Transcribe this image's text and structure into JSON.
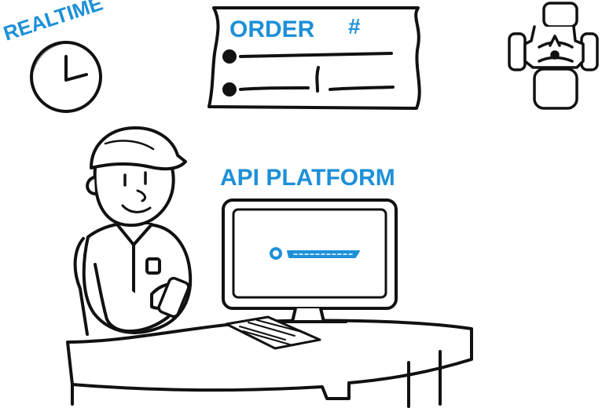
{
  "labels": {
    "realtime": "REALTIME",
    "order": "ORDER",
    "order_hash": "#",
    "api_platform": "API PLATFORM"
  },
  "colors": {
    "ink": "#111111",
    "accent_blue": "#1e90d8",
    "paper": "#ffffff",
    "soft_gray": "#f3f3f3"
  },
  "icons": {
    "clock": "clock-icon",
    "order_ticket": "order-ticket-icon",
    "universal_joint": "universal-joint-icon",
    "worker": "worker-icon",
    "computer": "computer-icon",
    "keyboard": "keyboard-icon",
    "phone": "phone-icon"
  }
}
